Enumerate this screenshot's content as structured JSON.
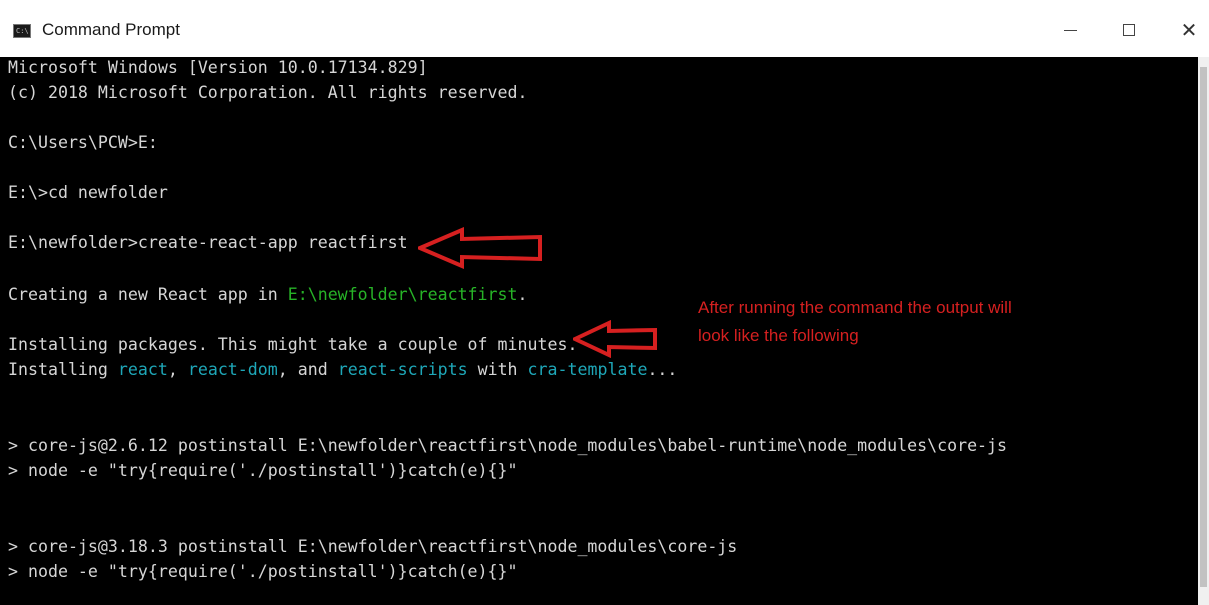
{
  "window": {
    "title": "Command Prompt",
    "icon": "console-icon",
    "icon_glyph": "C:\\",
    "controls": {
      "minimize": "–",
      "maximize": "□",
      "close": "✕"
    }
  },
  "terminal": {
    "header_line1": "Microsoft Windows [Version 10.0.17134.829]",
    "header_line2": "(c) 2018 Microsoft Corporation. All rights reserved.",
    "cmd1": "C:\\Users\\PCW>E:",
    "cmd2": "E:\\>cd newfolder",
    "cmd3": "E:\\newfolder>create-react-app reactfirst",
    "creating": {
      "prefix": "Creating a new React app in ",
      "path": "E:\\newfolder\\reactfirst",
      "suffix": "."
    },
    "installing_packages": "Installing packages. This might take a couple of minutes.",
    "installing": {
      "prefix": "Installing ",
      "pkg1": "react",
      "sep1": ", ",
      "pkg2": "react-dom",
      "sep2": ", and ",
      "pkg3": "react-scripts",
      "mid": " with ",
      "pkg4": "cra-template",
      "suffix": "..."
    },
    "corejs1_line1": "> core-js@2.6.12 postinstall E:\\newfolder\\reactfirst\\node_modules\\babel-runtime\\node_modules\\core-js",
    "corejs1_line2": "> node -e \"try{require('./postinstall')}catch(e){}\"",
    "corejs2_line1": "> core-js@3.18.3 postinstall E:\\newfolder\\reactfirst\\node_modules\\core-js",
    "corejs2_line2": "> node -e \"try{require('./postinstall')}catch(e){}\""
  },
  "annotation": {
    "line1": "After running the command the  output will",
    "line2": "look like the following",
    "color": "#d62020"
  },
  "colors": {
    "terminal_bg": "#000000",
    "terminal_text": "#d6d6d6",
    "path_green": "#27b327",
    "package_cyan": "#1ea7b8",
    "arrow_red": "#d62020"
  }
}
